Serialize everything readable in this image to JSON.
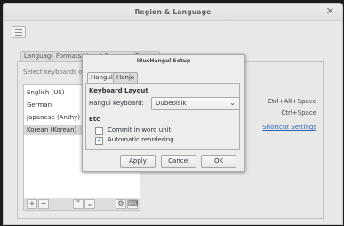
{
  "window": {
    "title": "Region & Language",
    "close_glyph": "✕"
  },
  "tabs": [
    "Language",
    "Formats",
    "Input Sources",
    "Region"
  ],
  "input_sources": {
    "hint": "Select keyboards or other input sources",
    "items": [
      {
        "label": "English (US)",
        "selected": false
      },
      {
        "label": "German",
        "selected": false
      },
      {
        "label": "Japanese (Anthy)",
        "selected": false
      },
      {
        "label": "Korean (Korean)",
        "selected": true
      }
    ],
    "toolbar": {
      "add": "+",
      "remove": "−",
      "up": "⌃",
      "down": "⌄",
      "settings_icon": "gear-icon",
      "keyboard_icon": "keyboard-icon"
    },
    "shortcut_1": "Ctrl+Alt+Space",
    "shortcut_2": "Ctrl+Space",
    "shortcut_settings": "Shortcut Settings"
  },
  "dialog": {
    "title": "IBusHangul Setup",
    "tabs": [
      "Hangul",
      "Hanja"
    ],
    "keyboard_layout_heading": "Keyboard Layout",
    "hangul_keyboard_label": "Hangul keyboard:",
    "hangul_keyboard_value": "Dubeolsik",
    "etc_heading": "Etc",
    "commit_label": "Commit in word unit",
    "commit_checked": false,
    "auto_reorder_label": "Automatic reordering",
    "auto_reorder_checked": true,
    "apply": "Apply",
    "cancel": "Cancel",
    "ok": "OK"
  }
}
